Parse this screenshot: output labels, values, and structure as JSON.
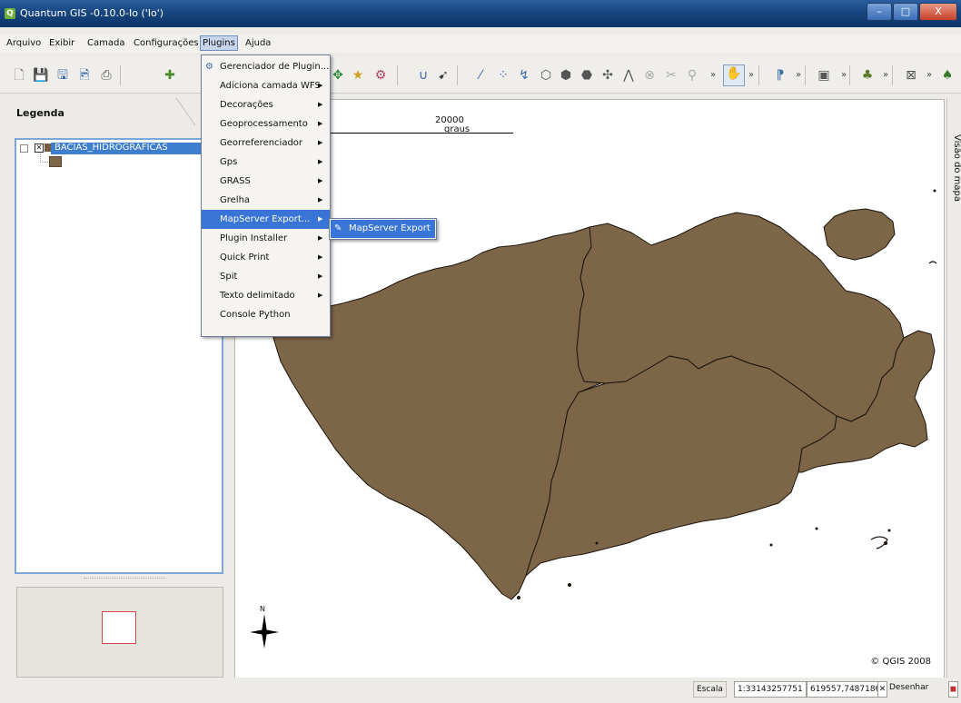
{
  "window": {
    "title": "Quantum GIS -0.10.0-Io ('Io')",
    "app_icon": "Q",
    "minimize": "–",
    "maximize": "□",
    "close": "X"
  },
  "menubar": {
    "items": [
      "Arquivo",
      "Exibir",
      "Camada",
      "Configurações",
      "Plugins",
      "Ajuda"
    ]
  },
  "toolbar": {
    "more": "»"
  },
  "plugins_menu": {
    "items": [
      {
        "label": "Gerenciador de Plugin..."
      },
      {
        "label": "Adiciona camada WFS",
        "arrow": "▶"
      },
      {
        "label": "Decorações",
        "arrow": "▶"
      },
      {
        "label": "Geoprocessamento",
        "arrow": "▶"
      },
      {
        "label": "Georreferenciador",
        "arrow": "▶"
      },
      {
        "label": "Gps",
        "arrow": "▶"
      },
      {
        "label": "GRASS",
        "arrow": "▶"
      },
      {
        "label": "Grelha",
        "arrow": "▶"
      },
      {
        "label": "MapServer Export...",
        "arrow": "▶"
      },
      {
        "label": "Plugin Installer",
        "arrow": "▶"
      },
      {
        "label": "Quick Print",
        "arrow": "▶"
      },
      {
        "label": "Spit",
        "arrow": "▶"
      },
      {
        "label": "Texto delimitado",
        "arrow": "▶"
      },
      {
        "label": "Console Python"
      }
    ]
  },
  "submenu": {
    "label": "MapServer Export"
  },
  "legend": {
    "title": "Legenda",
    "layer": "BACIAS_HIDROGRAFICAS",
    "layer_color": "#7d6548"
  },
  "map": {
    "scale_value": "20000",
    "scale_unit": "graus",
    "north_label": "N",
    "copyright": "© QGIS 2008",
    "fill_color": "#7d6548"
  },
  "right_dock": {
    "label": "Visão do mapa"
  },
  "status": {
    "scale_label": "Escala",
    "scale_value": "1:33143257751",
    "coords": "619557,7487186",
    "render_label": "Desenhar"
  }
}
